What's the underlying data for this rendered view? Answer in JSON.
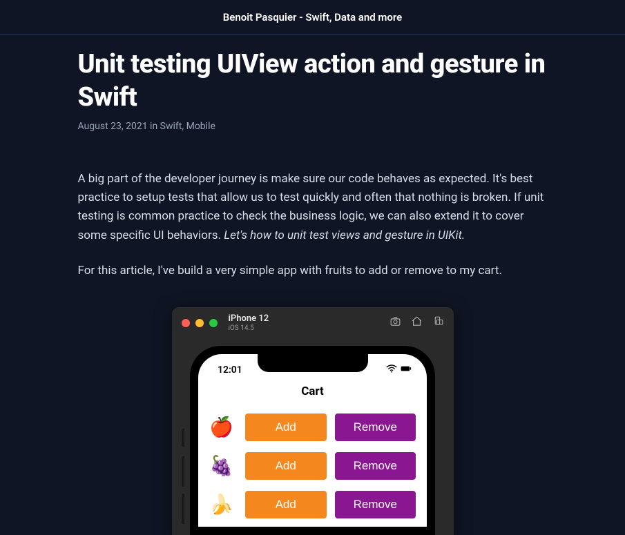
{
  "header": {
    "site_title": "Benoit Pasquier - Swift, Data and more"
  },
  "article": {
    "title": "Unit testing UIView action and gesture in Swift",
    "date": "August 23, 2021",
    "meta_in": " in ",
    "tag1": "Swift",
    "tag_sep": ", ",
    "tag2": "Mobile",
    "p1_a": "A big part of the developer journey is make sure our code behaves as expected. It's best practice to setup tests that allow us to test quickly and often that nothing is broken. If unit testing is common practice to check the business logic, we can also extend it to cover some specific UI behaviors. ",
    "p1_em": "Let's how to unit test views and gesture in UIKit.",
    "p2": "For this article, I've build a very simple app with fruits to add or remove to my cart."
  },
  "simulator": {
    "device": "iPhone 12",
    "os": "iOS 14.5",
    "time": "12:01",
    "screen_title": "Cart",
    "add_label": "Add",
    "remove_label": "Remove",
    "fruits": {
      "apple": "🍎",
      "grapes": "🍇",
      "banana": "🍌"
    }
  }
}
